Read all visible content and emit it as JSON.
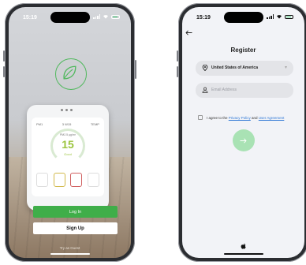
{
  "status": {
    "time": "15:19"
  },
  "welcome": {
    "device": {
      "top_left": "PM1",
      "top_mid": "3 W15",
      "top_right": "TEMP",
      "label": "PM2.5 µg/m³",
      "value": "15",
      "status": "Good"
    },
    "login_label": "Log In",
    "signup_label": "Sign Up",
    "guest_label": "Try as Guest",
    "colors": {
      "brand_green": "#3fae49"
    }
  },
  "register": {
    "title": "Register",
    "country": "United States of America",
    "email_placeholder": "Email Address",
    "agree_prefix": "I agree to the ",
    "privacy_label": "Privacy Policy",
    "agree_and": " and ",
    "user_agreement_label": "User Agreement",
    "icons": [
      "back-arrow-icon",
      "location-pin-icon",
      "user-icon",
      "chevron-down-icon",
      "arrow-right-icon",
      "apple-icon"
    ]
  }
}
